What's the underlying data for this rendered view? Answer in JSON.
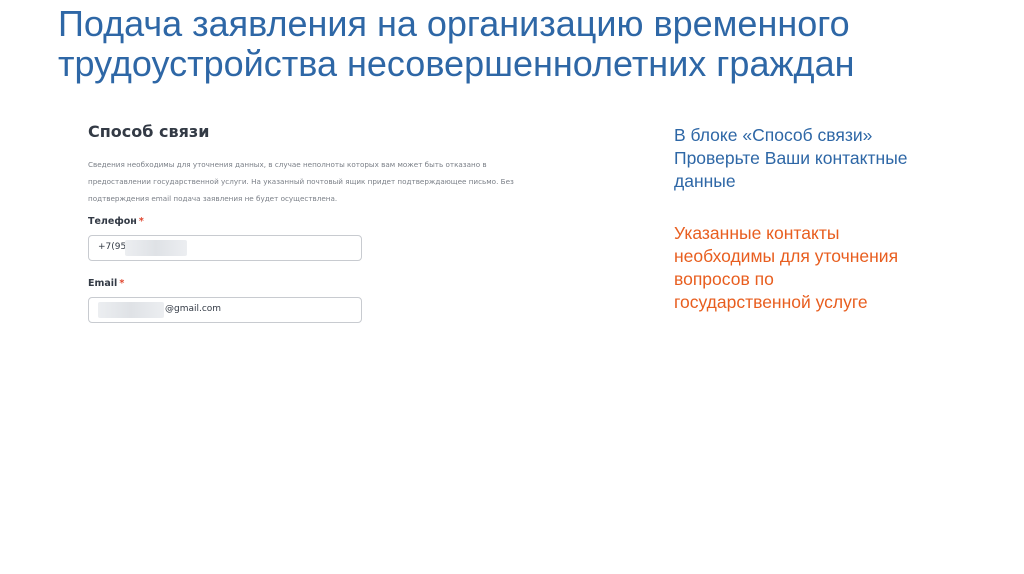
{
  "slide": {
    "title_line1": "Подача заявления на организацию временного",
    "title_line2": "трудоустройства несовершеннолетних граждан"
  },
  "form": {
    "heading": "Способ связи",
    "description": [
      "Сведения необходимы для уточнения данных, в случае неполноты которых вам может быть отказано в",
      "предоставлении государственной услуги. На указанный почтовый ящик придет подтверждающее письмо. Без",
      "подтверждения email подача заявления не будет осуществлена."
    ],
    "required_marker": "*",
    "phone": {
      "label": "Телефон",
      "value": "+7(950"
    },
    "email": {
      "label": "Email",
      "value": "@gmail.com"
    }
  },
  "notes": {
    "block1": [
      "В блоке «Способ связи»",
      "Проверьте Ваши контактные",
      "данные"
    ],
    "block2": [
      "Указанные контакты",
      "необходимы для уточнения",
      "вопросов по",
      "государственной услуге"
    ]
  },
  "colors": {
    "title": "#2e67a6",
    "note_info": "#2e67a6",
    "note_accent": "#e85e1f",
    "required": "#e0452e"
  }
}
